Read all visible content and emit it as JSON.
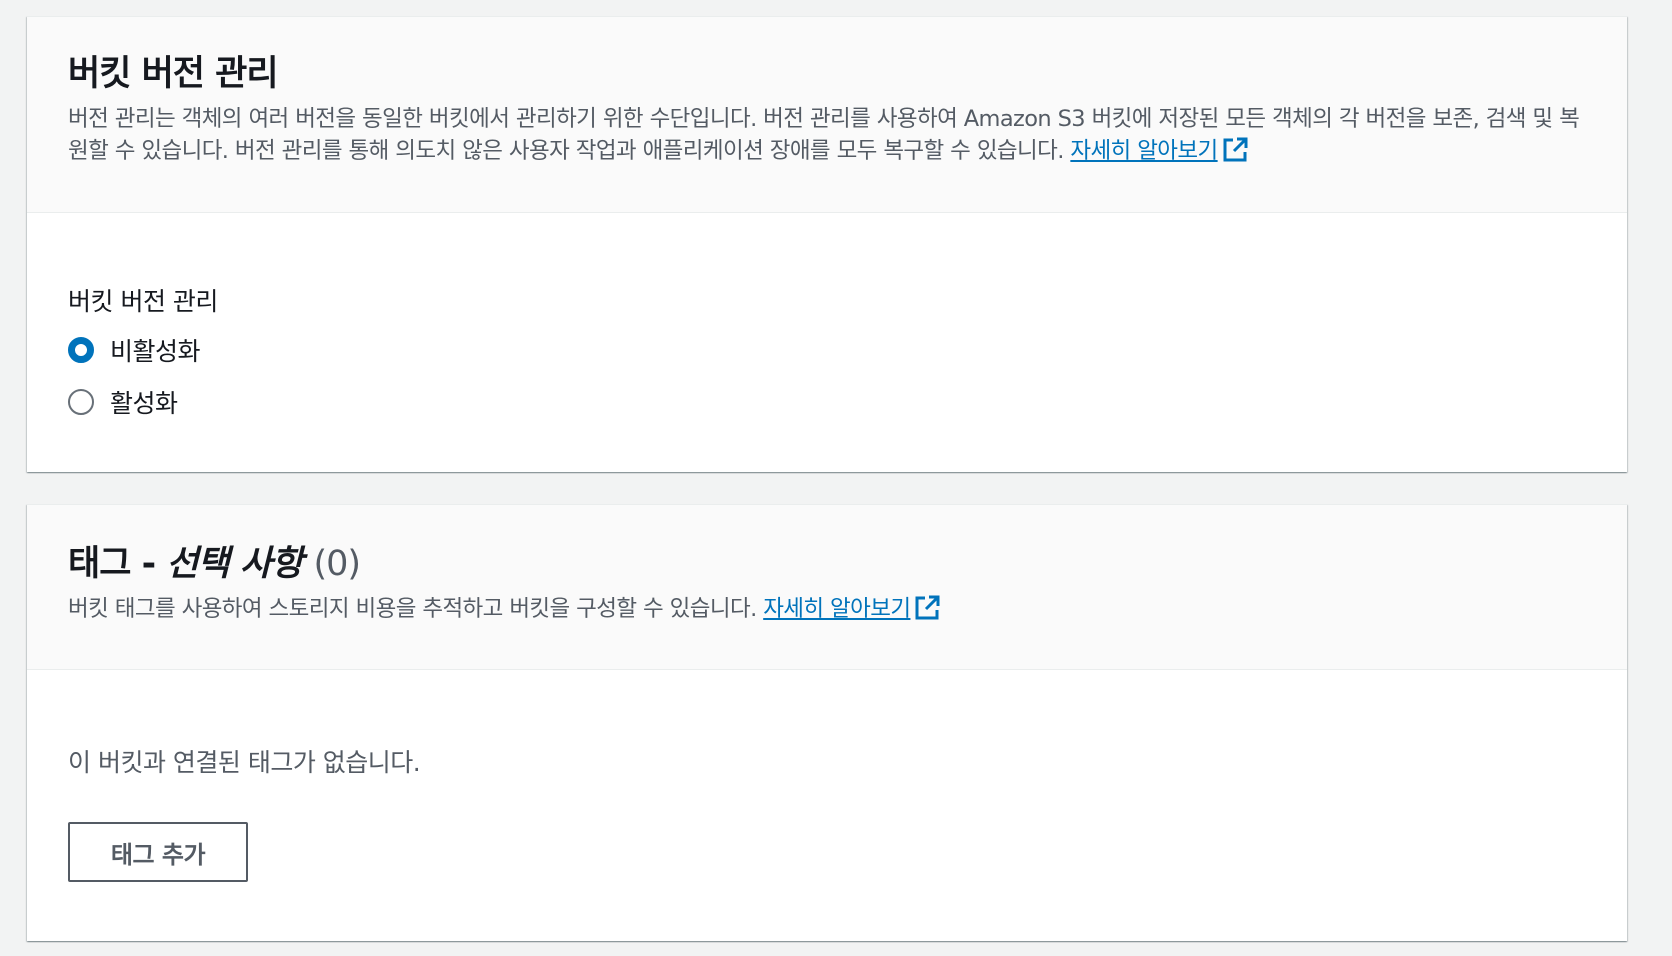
{
  "versioning": {
    "title": "버킷 버전 관리",
    "description": "버전 관리는 객체의 여러 버전을 동일한 버킷에서 관리하기 위한 수단입니다. 버전 관리를 사용하여 Amazon S3 버킷에 저장된 모든 객체의 각 버전을 보존, 검색 및 복원할 수 있습니다. 버전 관리를 통해 의도치 않은 사용자 작업과 애플리케이션 장애를 모두 복구할 수 있습니다.",
    "learn_more": "자세히 알아보기",
    "field_label": "버킷 버전 관리",
    "options": [
      {
        "label": "비활성화",
        "selected": true
      },
      {
        "label": "활성화",
        "selected": false
      }
    ]
  },
  "tags": {
    "title": "태그 - ",
    "title_optional": "선택 사항",
    "title_count": "(0)",
    "description": "버킷 태그를 사용하여 스토리지 비용을 추적하고 버킷을 구성할 수 있습니다.",
    "learn_more": "자세히 알아보기",
    "empty_text": "이 버킷과 연결된 태그가 없습니다.",
    "add_button": "태그 추가"
  },
  "colors": {
    "accent": "#0073bb",
    "background": "#f2f3f3",
    "header_bg": "#fafafa",
    "text_secondary": "#545b64"
  },
  "icons": {
    "external_link": "external-link-icon"
  }
}
